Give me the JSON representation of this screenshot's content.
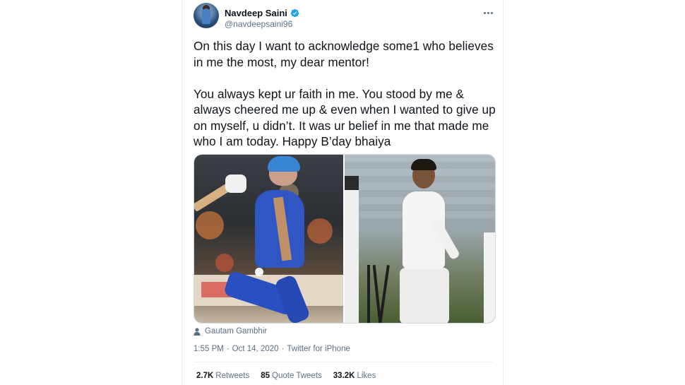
{
  "author": {
    "display_name": "Navdeep Saini",
    "handle": "@navdeepsaini96",
    "verified": true
  },
  "tweet": {
    "text": "On this day I want to acknowledge some1 who believes in me the most, my dear mentor!\n\nYou always kept ur faith in me. You stood by me & always cheered me up & even when I wanted to give up on myself, u didn’t. It was ur belief in me that made me who I am today. Happy B’day bhaiya",
    "media_tag": "Gautam Gambhir"
  },
  "meta": {
    "time": "1:55 PM",
    "date": "Oct 14, 2020",
    "separator": "·",
    "source": "Twitter for iPhone"
  },
  "stats": [
    {
      "count": "2.7K",
      "label": "Retweets"
    },
    {
      "count": "85",
      "label": "Quote Tweets"
    },
    {
      "count": "33.2K",
      "label": "Likes"
    }
  ],
  "icons": {
    "verified": "verified-badge-icon",
    "more": "more-options-icon",
    "person": "person-tag-icon"
  },
  "colors": {
    "text": "#0f1419",
    "secondary": "#5b7083",
    "verified": "#1da1f2",
    "border": "#ebeef0"
  }
}
